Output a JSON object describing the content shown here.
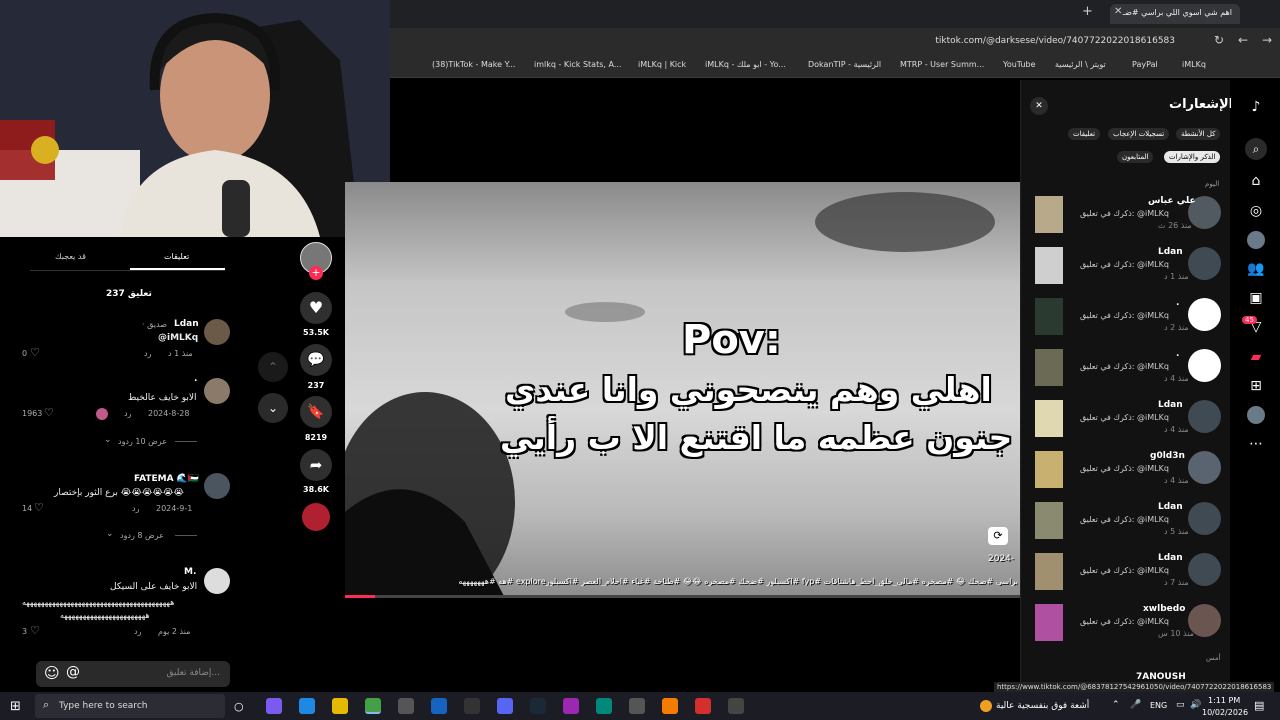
{
  "browser": {
    "tabs": [
      {
        "label": "اهم شي اسوي اللي براسي #ضـ"
      }
    ],
    "new_tab": "+",
    "url": "tiktok.com/@darksese/video/7407722022018616583",
    "bookmarks": [
      "(38)TikTok - Make Y...",
      "imlkq - Kick Stats, A...",
      "iMLKq | Kick",
      "iMLKq - ابو ملك - Yo...",
      "DokanTIP - الرئيسية",
      "MTRP - User Summ...",
      "YouTube",
      "تويتر \\ الرئيسية",
      "PayPal",
      "iMLKq"
    ],
    "status_url": "https://www.tiktok.com/@68378127542961050/video/7407722022018616583"
  },
  "comments_panel": {
    "tabs": [
      "تعليقات",
      "قد يعجبك"
    ],
    "count_label": "237 تعليق",
    "comments": [
      {
        "name": "Ldan",
        "suffix": "· صديق",
        "text": "@iMLKq",
        "date": "منذ 1 د",
        "reply": "رد",
        "likes": "0"
      },
      {
        "name": ".",
        "text": "الابو خايف عالخيط",
        "date": "2024-8-28",
        "reply": "رد",
        "likes": "1963",
        "view_replies": "عرض 10 ردود"
      },
      {
        "name": "FATEMA 🌊🇵🇸",
        "text": "برع الثور بإختصار 😭😭😭😭😭😭",
        "date": "2024-9-1",
        "reply": "رد",
        "likes": "14",
        "view_replies": "عرض 8 ردود"
      },
      {
        "name": "M.",
        "text": "الابو خايف على السيكل",
        "text2": "ههههههههههههههههههههههههههههههههههههههههه",
        "text3": "هههههههههههههههههههههههه",
        "date": "منذ 2 يوم",
        "reply": "رد",
        "likes": "3"
      }
    ],
    "add_comment_placeholder": "إضافة تعليق...",
    "emoji": "☺",
    "at": "@"
  },
  "actions": {
    "likes": "53.5K",
    "comments": "237",
    "saves": "8219",
    "shares": "38.6K"
  },
  "video": {
    "overlay_line1": "Pov:",
    "overlay_line2": "اهلي وهم ينصحوني وانا عندي",
    "overlay_line3": "جنون عظمه ما اقتنع الا ب رأيي",
    "caption": "براسي #ضحك 😂 #مصخره #مالي_خلق_احط_هاشتاقات #fyp #اكسبلور #ضحك #مصخره 😂😂 #طناخة #غباء #احلام_العصر #اكسبلورexplore #هه #هههههههه",
    "date": "2024-"
  },
  "notifications": {
    "title": "الإشعارات",
    "filters": [
      "كل الأنشطة",
      "تسجيلات الإعجاب",
      "تعليقات",
      "الذكر والإشارات",
      "المتابعون"
    ],
    "section_today": "اليوم",
    "section_yesterday": "أمس",
    "items": [
      {
        "name": "علي عباس",
        "text": "ذكرك في تعليق: @iMLKq",
        "ago": "منذ 26 ث"
      },
      {
        "name": "Ldan",
        "text": "ذكرك في تعليق: @iMLKq",
        "ago": "منذ 1 د"
      },
      {
        "name": ".",
        "text": "ذكرك في تعليق: @iMLKq",
        "ago": "منذ 2 د"
      },
      {
        "name": ".",
        "text": "ذكرك في تعليق: @iMLKq",
        "ago": "منذ 4 د"
      },
      {
        "name": "Ldan",
        "text": "ذكرك في تعليق: @iMLKq",
        "ago": "منذ 4 د"
      },
      {
        "name": "g0ld3n",
        "text": "ذكرك في تعليق: @iMLKq",
        "ago": "منذ 4 د"
      },
      {
        "name": "Ldan",
        "text": "ذكرك في تعليق: @iMLKq",
        "ago": "منذ 5 د"
      },
      {
        "name": "Ldan",
        "text": "ذكرك في تعليق: @iMLKq",
        "ago": "منذ 7 د"
      },
      {
        "name": "xwlbedo",
        "text": "ذكرك في تعليق: @iMLKq",
        "ago": "منذ 10 س"
      },
      {
        "name": "7ANOUSH",
        "text": "",
        "ago": ""
      }
    ],
    "badge": "45"
  },
  "taskbar": {
    "search_placeholder": "Type here to search",
    "weather_text": "أشعة فوق بنفسجية عالية",
    "language": "ENG",
    "time": "1:11 PM",
    "date": "10/02/2026"
  },
  "colors": {
    "accent": "#fe2c55",
    "bg": "#000000",
    "panel": "#121212"
  }
}
